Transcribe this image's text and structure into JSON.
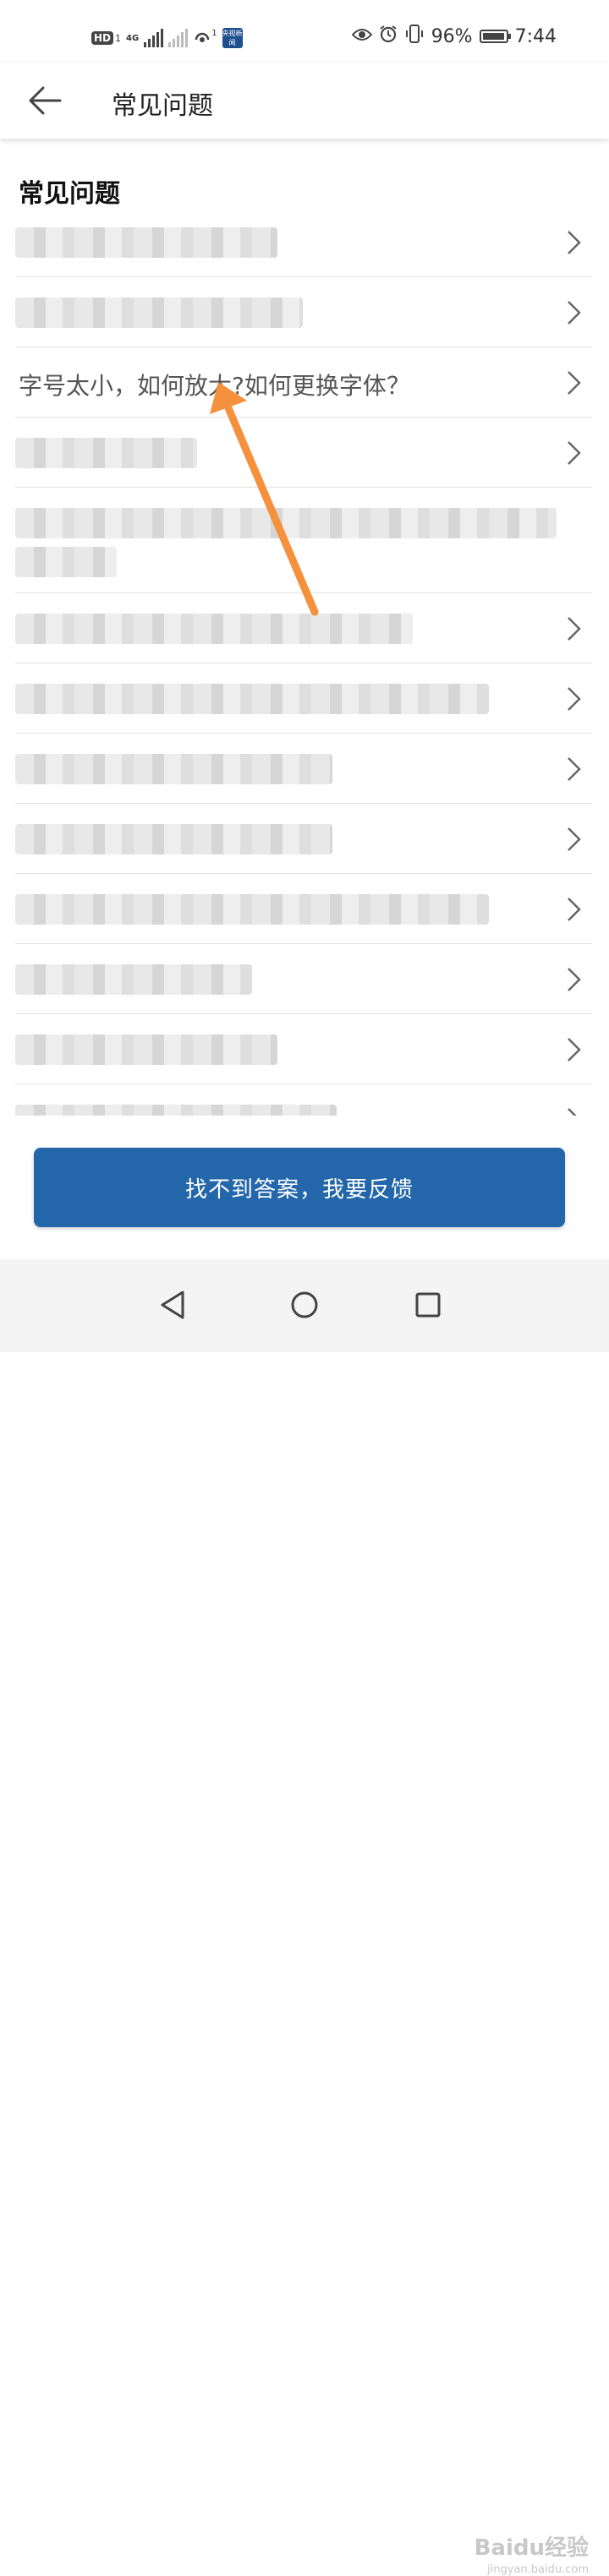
{
  "status_bar": {
    "hd": "HD",
    "sim": "1",
    "network": "4G",
    "hotspot_count": "1",
    "app_icon_text": "央视新闻",
    "battery_percent": "96%",
    "battery_level": 0.96,
    "time": "7:44",
    "icons": [
      "eye-icon",
      "alarm-icon",
      "vibrate-icon",
      "battery-icon"
    ]
  },
  "header": {
    "title": "常见问题",
    "back_icon": "back-arrow-icon"
  },
  "section": {
    "title": "常见问题"
  },
  "faq_items": [
    {
      "label": "",
      "blurred": true
    },
    {
      "label": "",
      "blurred": true
    },
    {
      "label": "字号太小，如何放大?如何更换字体？",
      "blurred": false
    },
    {
      "label": "",
      "blurred": true
    },
    {
      "label": "",
      "blurred": true
    },
    {
      "label": "",
      "blurred": true
    },
    {
      "label": "",
      "blurred": true
    },
    {
      "label": "",
      "blurred": true
    },
    {
      "label": "",
      "blurred": true
    },
    {
      "label": "",
      "blurred": true
    },
    {
      "label": "",
      "blurred": true
    },
    {
      "label": "",
      "blurred": true
    },
    {
      "label": "",
      "blurred": true
    }
  ],
  "feedback_button": {
    "label": "找不到答案，我要反馈"
  },
  "nav_bar": {
    "icons": [
      "back-triangle-icon",
      "home-circle-icon",
      "recents-square-icon"
    ]
  },
  "watermark": {
    "brand": "Baidu经验",
    "url": "jingyan.baidu.com"
  },
  "colors": {
    "accent": "#2466aa",
    "annotation_arrow": "#f5913c"
  }
}
